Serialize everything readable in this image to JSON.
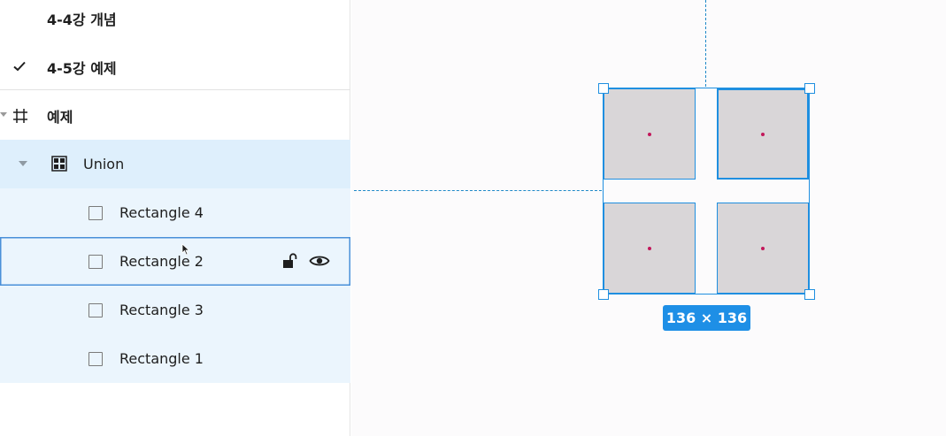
{
  "layers_panel": {
    "pages": [
      {
        "label": "4-4강 개념",
        "checked": false
      },
      {
        "label": "4-5강 예제",
        "checked": true
      }
    ],
    "frame": {
      "label": "예제",
      "icon": "hash-frame-icon"
    },
    "union": {
      "label": "Union",
      "icon": "union-icon"
    },
    "children": [
      {
        "label": "Rectangle 4",
        "icon": "rectangle-icon"
      },
      {
        "label": "Rectangle 2",
        "icon": "rectangle-icon",
        "hovered": true
      },
      {
        "label": "Rectangle 3",
        "icon": "rectangle-icon"
      },
      {
        "label": "Rectangle 1",
        "icon": "rectangle-icon"
      }
    ],
    "hover_actions": [
      "unlock-icon",
      "eye-icon"
    ]
  },
  "canvas": {
    "selection_size": "136 × 136",
    "colors": {
      "selection": "#1f8fe0",
      "guide": "#1e88c7",
      "shape_fill": "#d9d6d8",
      "highlight_row": "#deeffc",
      "child_row": "#ebf5fd"
    }
  }
}
